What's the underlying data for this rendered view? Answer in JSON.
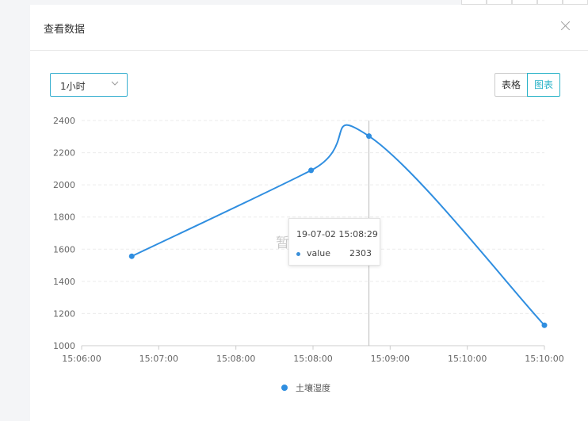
{
  "dialog": {
    "title": "查看数据",
    "close_icon": "close-icon"
  },
  "filter": {
    "range_value": "1小时"
  },
  "view_toggle": {
    "table_label": "表格",
    "chart_label": "图表",
    "active": "chart",
    "accent_color": "#2bb3c8"
  },
  "empty_hint": "暂",
  "tooltip": {
    "time": "19-07-02 15:08:29",
    "series_label": "value",
    "value": "2303"
  },
  "chart_data": {
    "type": "line",
    "x_ticks": [
      "15:06:00",
      "15:07:00",
      "15:08:00",
      "15:08:00",
      "15:09:00",
      "15:10:00",
      "15:10:00"
    ],
    "y_ticks": [
      1000,
      1200,
      1400,
      1600,
      1800,
      2000,
      2200,
      2400
    ],
    "ylim": [
      1000,
      2400
    ],
    "points": [
      {
        "x": "15:06:26",
        "y": 1556
      },
      {
        "x": "15:07:59",
        "y": 2090
      },
      {
        "x": "15:08:29",
        "y": 2303
      },
      {
        "x": "15:10:00",
        "y": 1127
      }
    ],
    "series": [
      {
        "name": "土壤湿度",
        "color": "#2f8ee0"
      }
    ],
    "grid": true,
    "legend_position": "bottom"
  }
}
